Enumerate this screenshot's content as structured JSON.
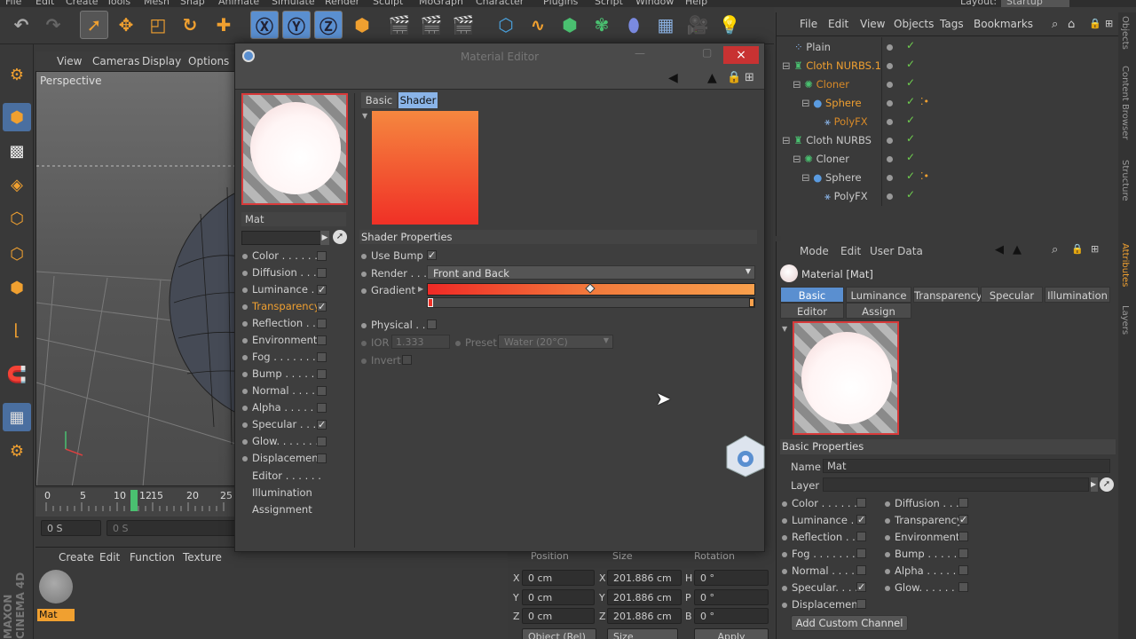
{
  "menubar": {
    "items": [
      "File",
      "Edit",
      "Create",
      "Tools",
      "Mesh",
      "Snap",
      "Animate",
      "Simulate",
      "Render",
      "Sculpt",
      "MoGraph",
      "Character",
      "Plugins",
      "Script",
      "Window",
      "Help"
    ],
    "layout_label": "Layout:",
    "layout_value": "Startup"
  },
  "viewport": {
    "menu": [
      "View",
      "Cameras",
      "Display",
      "Options"
    ],
    "label": "Perspective"
  },
  "timeline": {
    "ticks": [
      "0",
      "5",
      "10",
      "12",
      "15",
      "20",
      "25"
    ],
    "current_frame": "0 S",
    "frame_field": "0 S"
  },
  "material_manager": {
    "menu": [
      "Create",
      "Edit",
      "Function",
      "Texture"
    ],
    "material_name": "Mat"
  },
  "coordinates": {
    "headers": [
      "Position",
      "Size",
      "Rotation"
    ],
    "rows": [
      {
        "axis": "X",
        "pos": "0 cm",
        "size_axis": "X",
        "size": "201.886 cm",
        "rot_axis": "H",
        "rot": "0 °"
      },
      {
        "axis": "Y",
        "pos": "0 cm",
        "size_axis": "Y",
        "size": "201.886 cm",
        "rot_axis": "P",
        "rot": "0 °"
      },
      {
        "axis": "Z",
        "pos": "0 cm",
        "size_axis": "Z",
        "size": "201.886 cm",
        "rot_axis": "B",
        "rot": "0 °"
      }
    ],
    "mode_dropdown": "Object (Rel)",
    "size_dropdown": "Size",
    "apply_label": "Apply"
  },
  "material_editor": {
    "title": "Material Editor",
    "close_icon": "×",
    "mat_name": "Mat",
    "channels": [
      {
        "label": "Color . . . . . .",
        "checked": false
      },
      {
        "label": "Diffusion . . .",
        "checked": false
      },
      {
        "label": "Luminance . .",
        "checked": true
      },
      {
        "label": "Transparency",
        "checked": true,
        "active": true
      },
      {
        "label": "Reflection . .",
        "checked": false
      },
      {
        "label": "Environment",
        "checked": false
      },
      {
        "label": "Fog . . . . . . .",
        "checked": false
      },
      {
        "label": "Bump . . . . . .",
        "checked": false
      },
      {
        "label": "Normal . . . . .",
        "checked": false
      },
      {
        "label": "Alpha . . . . . .",
        "checked": false
      },
      {
        "label": "Specular . . . .",
        "checked": true
      },
      {
        "label": "Glow. . . . . . .",
        "checked": false
      },
      {
        "label": "Displacement",
        "checked": false
      }
    ],
    "extras": [
      "Editor . . . . . .",
      "Illumination",
      "Assignment"
    ],
    "tabs": [
      "Basic",
      "Shader"
    ],
    "shader_properties_title": "Shader Properties",
    "use_bump_label": "Use Bump",
    "render_label": "Render . . . .",
    "render_value": "Front and Back",
    "gradient_label": "Gradient",
    "physical_label": "Physical . .",
    "ior_label": "IOR",
    "ior_value": "1.333",
    "preset_label": "Preset",
    "preset_value": "Water (20°C)",
    "invert_label": "Invert",
    "gradient_colors": [
      "#f02a26",
      "#f27a3c",
      "#f9a04c"
    ]
  },
  "object_manager": {
    "menu": [
      "File",
      "Edit",
      "View",
      "Objects",
      "Tags",
      "Bookmarks"
    ],
    "objects": [
      {
        "name": "Plain",
        "indent": 0,
        "color": "#c8c8c8"
      },
      {
        "name": "Cloth NURBS.1",
        "indent": 0,
        "color": "#f0a030"
      },
      {
        "name": "Cloner",
        "indent": 1,
        "color": "#d88a28"
      },
      {
        "name": "Sphere",
        "indent": 2,
        "color": "#f0a030"
      },
      {
        "name": "PolyFX",
        "indent": 3,
        "color": "#d88a28"
      },
      {
        "name": "Cloth NURBS",
        "indent": 0,
        "color": "#c8c8c8"
      },
      {
        "name": "Cloner",
        "indent": 1,
        "color": "#c8c8c8"
      },
      {
        "name": "Sphere",
        "indent": 2,
        "color": "#c8c8c8"
      },
      {
        "name": "PolyFX",
        "indent": 3,
        "color": "#c8c8c8"
      }
    ]
  },
  "attribute_manager": {
    "menu": [
      "Mode",
      "Edit",
      "User Data"
    ],
    "object_title": "Material [Mat]",
    "tabs_row1": [
      "Basic",
      "Luminance",
      "Transparency",
      "Specular",
      "Illumination"
    ],
    "tabs_row2": [
      "Editor",
      "Assign"
    ],
    "section": "Basic Properties",
    "name_label": "Name",
    "name_value": "Mat",
    "layer_label": "Layer",
    "left_channels": [
      {
        "label": "Color . . . . . .",
        "checked": false
      },
      {
        "label": "Luminance . .",
        "checked": true
      },
      {
        "label": "Reflection . .",
        "checked": false
      },
      {
        "label": "Fog . . . . . . .",
        "checked": false
      },
      {
        "label": "Normal . . . . .",
        "checked": false
      },
      {
        "label": "Specular. . . .",
        "checked": true
      },
      {
        "label": "Displacement",
        "checked": false
      }
    ],
    "right_channels": [
      {
        "label": "Diffusion . . .",
        "checked": false
      },
      {
        "label": "Transparency",
        "checked": true
      },
      {
        "label": "Environment",
        "checked": false
      },
      {
        "label": "Bump . . . . . .",
        "checked": false
      },
      {
        "label": "Alpha . . . . . .",
        "checked": false
      },
      {
        "label": "Glow. . . . . . .",
        "checked": false
      }
    ],
    "add_channel_label": "Add Custom Channel"
  },
  "side_tabs": [
    "Objects",
    "Content Browser",
    "Structure",
    "Attributes",
    "Layers"
  ],
  "watermark": "MAXON CINEMA 4D",
  "accent": "#5a8fd0",
  "highlight": "#f0a030"
}
